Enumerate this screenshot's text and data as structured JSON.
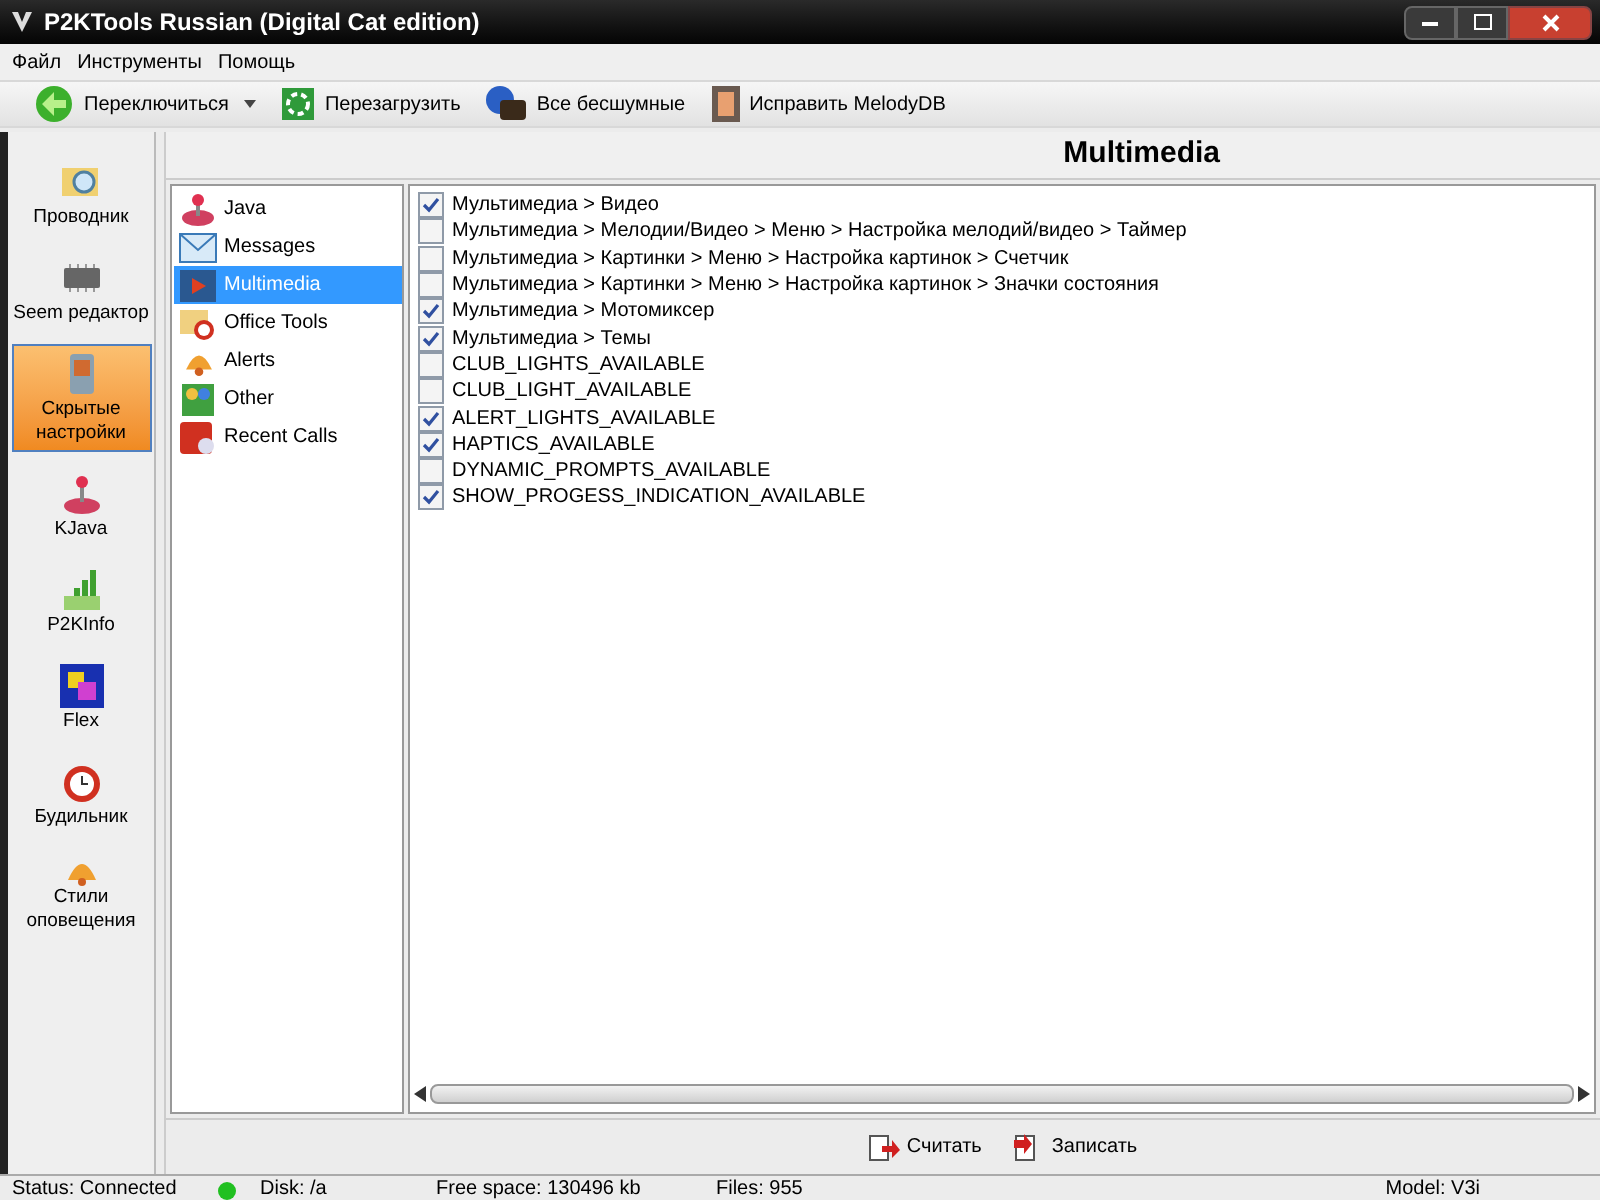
{
  "window": {
    "title": "P2KTools Russian (Digital Cat edition)"
  },
  "menu": [
    "Файл",
    "Инструменты",
    "Помощь"
  ],
  "toolbar": [
    {
      "label": "Переключиться",
      "kind": "dropdown"
    },
    {
      "label": "Перезагрузить",
      "kind": "button"
    },
    {
      "label": "Все бесшумные",
      "kind": "button"
    },
    {
      "label": "Исправить MelodyDB",
      "kind": "button"
    }
  ],
  "sidebar": {
    "items": [
      {
        "label": "Проводник",
        "selected": false
      },
      {
        "label": "Seem редактор",
        "selected": false
      },
      {
        "label": "Скрытые настройки",
        "selected": true
      },
      {
        "label": "KJava",
        "selected": false
      },
      {
        "label": "P2KInfo",
        "selected": false
      },
      {
        "label": "Flex",
        "selected": false
      },
      {
        "label": "Будильник",
        "selected": false
      },
      {
        "label": "Стили оповещения",
        "selected": false
      }
    ]
  },
  "panel": {
    "title": "Multimedia"
  },
  "categories": [
    {
      "label": "Java",
      "selected": false
    },
    {
      "label": "Messages",
      "selected": false
    },
    {
      "label": "Multimedia",
      "selected": true
    },
    {
      "label": "Office Tools",
      "selected": false
    },
    {
      "label": "Alerts",
      "selected": false
    },
    {
      "label": "Other",
      "selected": false
    },
    {
      "label": "Recent Calls",
      "selected": false
    }
  ],
  "settings": [
    {
      "label": "Мультимедиа > Видео",
      "checked": true
    },
    {
      "label": "Мультимедиа > Мелодии/Видео > Меню > Настройка мелодий/видео > Таймер",
      "checked": false
    },
    {
      "label": "Мультимедиа > Картинки > Меню > Настройка картинок > Счетчик",
      "checked": false
    },
    {
      "label": "Мультимедиа > Картинки > Меню > Настройка картинок > Значки состояния",
      "checked": false
    },
    {
      "label": "Мультимедиа > Мотомиксер",
      "checked": true
    },
    {
      "label": "Мультимедиа > Темы",
      "checked": true
    },
    {
      "label": "CLUB_LIGHTS_AVAILABLE",
      "checked": false
    },
    {
      "label": "CLUB_LIGHT_AVAILABLE",
      "checked": false
    },
    {
      "label": "ALERT_LIGHTS_AVAILABLE",
      "checked": true
    },
    {
      "label": "HAPTICS_AVAILABLE",
      "checked": true
    },
    {
      "label": "DYNAMIC_PROMPTS_AVAILABLE",
      "checked": false
    },
    {
      "label": "SHOW_PROGESS_INDICATION_AVAILABLE",
      "checked": true
    }
  ],
  "actions": [
    "Считать",
    "Записать"
  ],
  "status_bar": {
    "status": "Status: Connected",
    "connected": true,
    "disk": "Disk: /a",
    "free_space": "Free space: 130496 kb",
    "files": "Files: 955",
    "model": "Model: V3i"
  }
}
